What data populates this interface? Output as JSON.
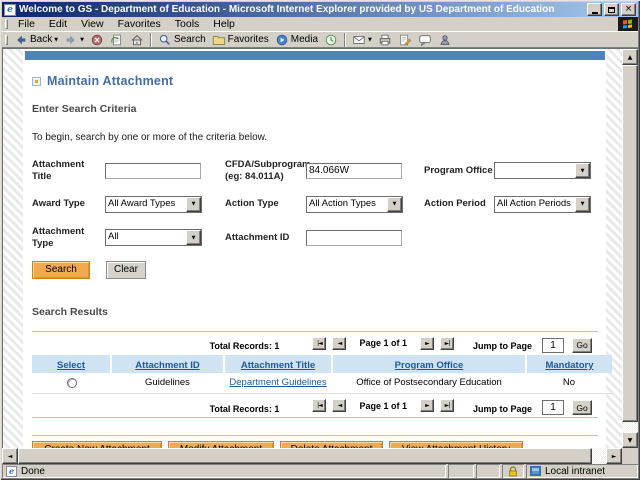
{
  "window": {
    "title": "Welcome to GS - Department of Education - Microsoft Internet Explorer provided by US Department of Education",
    "menu": [
      "File",
      "Edit",
      "View",
      "Favorites",
      "Tools",
      "Help"
    ],
    "toolbar": {
      "back_label": "Back",
      "search_label": "Search",
      "favorites_label": "Favorites",
      "media_label": "Media"
    },
    "status": {
      "done": "Done",
      "zone": "Local intranet"
    }
  },
  "page": {
    "heading": "Maintain Attachment",
    "criteria": {
      "title": "Enter Search Criteria",
      "instructions": "To begin, search by one or more of the criteria below.",
      "fields": {
        "attachment_title": {
          "label": "Attachment Title",
          "value": ""
        },
        "cfda": {
          "label": "CFDA/Subprogram",
          "label2": "(eg: 84.011A)",
          "value": "84.066W"
        },
        "program_office": {
          "label": "Program Office",
          "value": ""
        },
        "award_type": {
          "label": "Award Type",
          "value": "All Award Types"
        },
        "action_type": {
          "label": "Action Type",
          "value": "All Action Types"
        },
        "action_period": {
          "label": "Action Period",
          "value": "All Action Periods"
        },
        "attachment_type": {
          "label": "Attachment Type",
          "value": "All"
        },
        "attachment_id": {
          "label": "Attachment ID",
          "value": ""
        }
      },
      "search_label": "Search",
      "clear_label": "Clear"
    },
    "results": {
      "title": "Search Results",
      "pagination": {
        "total": "Total Records: 1",
        "page": "Page 1 of 1",
        "jump": "Jump to Page",
        "jump_value": "1",
        "go": "Go"
      },
      "columns": [
        "Select",
        "Attachment ID",
        "Attachment Title",
        "Program Office",
        "Mandatory"
      ],
      "rows": [
        {
          "id": "Guidelines",
          "title": "Department Guidelines",
          "office": "Office of Postsecondary Education",
          "mandatory": "No"
        }
      ]
    },
    "actions": [
      "Create New Attachment",
      "Modify Attachment",
      "Delete Attachment",
      "View Attachment History"
    ]
  },
  "colors": {
    "accent_orange": "#f4a950",
    "table_header_blue": "#cfe3f2",
    "banner_blue": "#4e82bd",
    "link_blue": "#1b5a9e",
    "titlebar_blue": "#0a246a"
  },
  "icons": {
    "close": "×",
    "caret": "▼",
    "up": "▲",
    "down": "▼",
    "left": "◄",
    "right": "►",
    "pager_first": "|◄",
    "pager_prev": "◄",
    "pager_next": "►",
    "pager_last": "►|"
  }
}
